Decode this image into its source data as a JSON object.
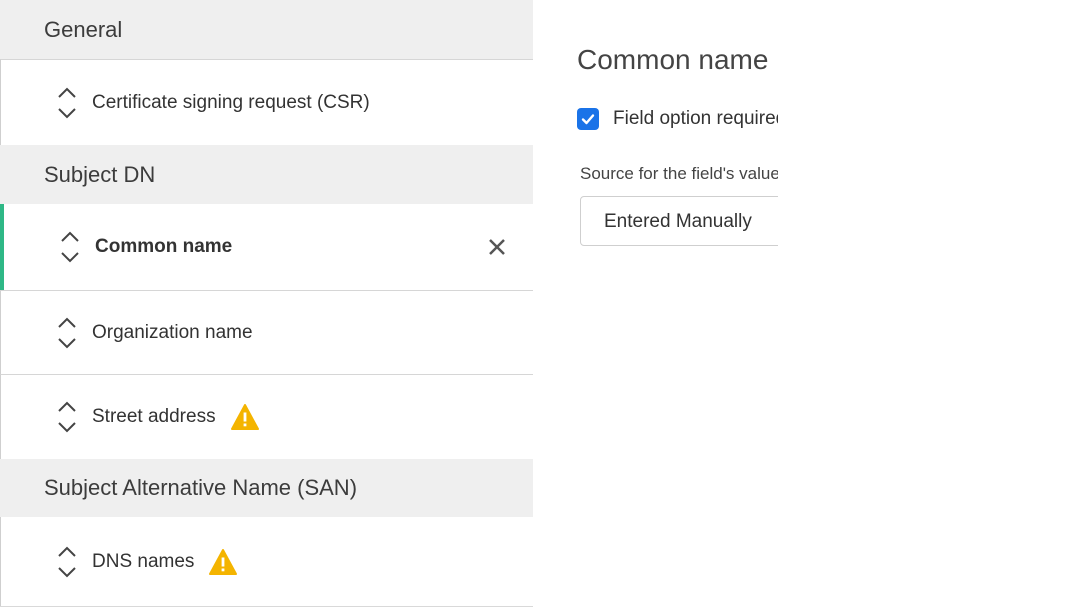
{
  "sidebar": {
    "groups": [
      {
        "label": "General"
      },
      {
        "label": "Subject DN"
      },
      {
        "label": "Subject Alternative Name (SAN)"
      }
    ],
    "items": [
      {
        "label": "Certificate signing request (CSR)",
        "warning": false
      },
      {
        "label": "Common name",
        "active": true,
        "warning": false
      },
      {
        "label": "Organization name",
        "warning": false
      },
      {
        "label": "Street address",
        "warning": true
      },
      {
        "label": "DNS names",
        "warning": true
      }
    ]
  },
  "detail": {
    "title": "Common name",
    "checkbox_label": "Field option required",
    "checkbox_checked": true,
    "source_label": "Source for the field's value",
    "source_value": "Entered Manually"
  },
  "colors": {
    "active_accent": "#2eb886",
    "warning": "#f4b400",
    "checkbox": "#1a73e8",
    "group_bg": "#efefef"
  },
  "icons": {
    "sort": "sort-updown-icon",
    "warning": "warning-icon",
    "close": "close-icon",
    "check": "check-icon"
  }
}
